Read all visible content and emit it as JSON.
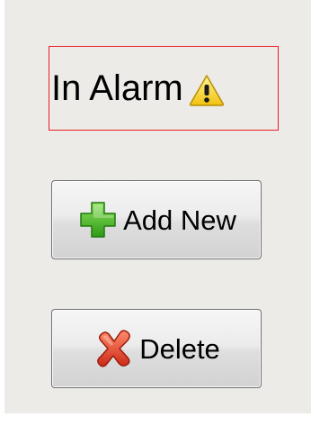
{
  "status": {
    "label": "In Alarm",
    "icon": "warning-icon",
    "border_color": "#e81e25"
  },
  "buttons": {
    "add": {
      "label": "Add New",
      "icon": "plus-icon",
      "icon_color": "#3fba22"
    },
    "delete": {
      "label": "Delete",
      "icon": "x-icon",
      "icon_color": "#e0402c"
    }
  }
}
